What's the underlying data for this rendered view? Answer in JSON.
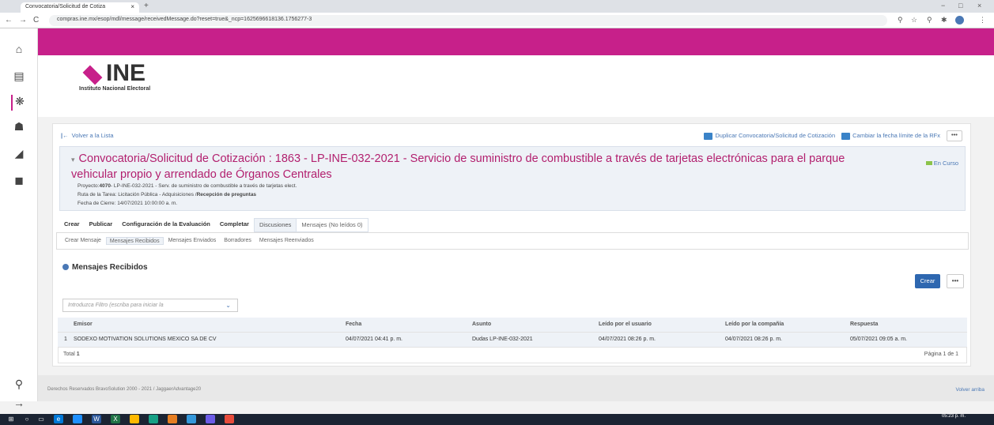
{
  "browser": {
    "tab_title": "Convocatoria/Solicitud de Cotiza",
    "tab_close": "×",
    "new_tab": "+",
    "url": "compras.ine.mx/esop/mdl/message/receivedMessage.do?reset=true&_ncp=1625696618136.1756277-3",
    "nav": {
      "back": "←",
      "forward": "→",
      "reload": "C"
    },
    "win_controls": {
      "min": "−",
      "max": "□",
      "close": "×"
    }
  },
  "left_nav": {
    "icons": [
      "home-icon",
      "inbox-icon",
      "handshake-icon",
      "team-icon",
      "chart-icon",
      "book-icon",
      "search-icon",
      "arrow-right-icon"
    ],
    "glyphs": [
      "⌂",
      "▤",
      "❋",
      "☗",
      "◢",
      "◼",
      "⚲",
      "→"
    ]
  },
  "logo": {
    "word": "INE",
    "subtitle": "Instituto Nacional Electoral"
  },
  "toolbar": {
    "back_label": "Volver a la Lista",
    "back_icon": "|←",
    "duplicate_label": "Duplicar Convocatoria/Solicitud de Cotización",
    "change_date_label": "Cambiar la fecha límite de la RFx",
    "more_label": "•••"
  },
  "rfx": {
    "title": "Convocatoria/Solicitud de Cotización : 1863 - LP-INE-032-2021 - Servicio de suministro de combustible a través de tarjetas electrónicas para el parque vehicular propio y arrendado de Órganos Centrales",
    "toggle": "▾",
    "status": "En Curso",
    "project_label": "Proyecto:",
    "project_code": "4070",
    "project_rest": "- LP-INE-032-2021 - Serv. de suministro de combustible a través de tarjetas elect.",
    "route_label": "Ruta de la Tarea: Licitación Pública - Adquisiciones /",
    "route_bold": "Recepción de preguntas",
    "close_date": "Fecha de Cierre: 14/07/2021 10:00:00 a. m."
  },
  "tabs_main": [
    "Crear",
    "Publicar",
    "Configuración de la Evaluación",
    "Completar",
    "Discusiones",
    "Mensajes (No leídos 0)"
  ],
  "tabs_sub": [
    "Crear Mensaje",
    "Mensajes Recibidos",
    "Mensajes Enviados",
    "Borradores",
    "Mensajes Reenviados"
  ],
  "section": {
    "title": "Mensajes Recibidos"
  },
  "buttons": {
    "crear": "Crear",
    "more": "•••"
  },
  "filter": {
    "placeholder": "Introduzca Filtro (escriba para iniciar la",
    "chevron": "⌄"
  },
  "table": {
    "headers": [
      "Emisor",
      "Fecha",
      "Asunto",
      "Leído por el usuario",
      "Leído por la compañía",
      "Respuesta"
    ],
    "rows": [
      {
        "num": "1",
        "emisor": "SODEXO MOTIVATION SOLUTIONS MEXICO SA DE CV",
        "fecha": "04/07/2021 04:41 p. m.",
        "asunto": "Dudas LP-INE-032-2021",
        "leido_usuario": "04/07/2021 08:26 p. m.",
        "leido_compania": "04/07/2021 08:26 p. m.",
        "respuesta": "05/07/2021 09:05 a. m."
      }
    ],
    "total_label": "Total",
    "total_value": "1",
    "pagination": "Página 1 de 1"
  },
  "footer": {
    "copyright": "Derechos Reservados BravoSolution 2000 - 2021 / JaggaerAdvantage20",
    "back_to_top": "Volver arriba"
  },
  "taskbar": {
    "time": "05:23 p. m.",
    "date": "",
    "colors": [
      "#0078d7",
      "#ffb900",
      "#1e90ff",
      "#217346",
      "#2b579a",
      "#e74c3c",
      "#f39c12",
      "#3498db",
      "#6c5ce7",
      "#e67e22",
      "#16a085"
    ]
  },
  "colors": {
    "brand": "#c7208a",
    "accent": "#4a78b5",
    "title": "#b21f6e"
  }
}
